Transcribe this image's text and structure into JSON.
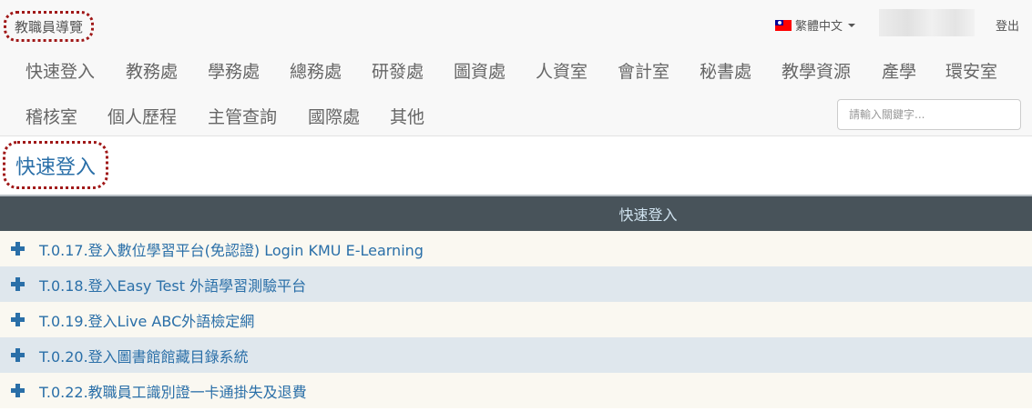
{
  "header": {
    "brand": "教職員導覽",
    "language": "繁體中文",
    "logout": "登出",
    "search_placeholder": "請輸入關鍵字..."
  },
  "nav": {
    "row1": [
      "快速登入",
      "教務處",
      "學務處",
      "總務處",
      "研發處",
      "圖資處",
      "人資室",
      "會計室",
      "秘書處",
      "教學資源",
      "產學",
      "環安室"
    ],
    "row2": [
      "稽核室",
      "個人歷程",
      "主管查詢",
      "國際處",
      "其他"
    ]
  },
  "page_title": "快速登入",
  "table": {
    "header": "快速登入",
    "items": [
      "T.0.17.登入數位學習平台(免認證) Login KMU E-Learning",
      "T.0.18.登入Easy Test 外語學習測驗平台",
      "T.0.19.登入Live ABC外語檢定網",
      "T.0.20.登入圖書館館藏目錄系統",
      "T.0.22.教職員工識別證一卡通掛失及退費"
    ]
  },
  "colors": {
    "accent": "#2a6fa8",
    "header_bg": "#48535a",
    "highlight": "#a01818"
  }
}
